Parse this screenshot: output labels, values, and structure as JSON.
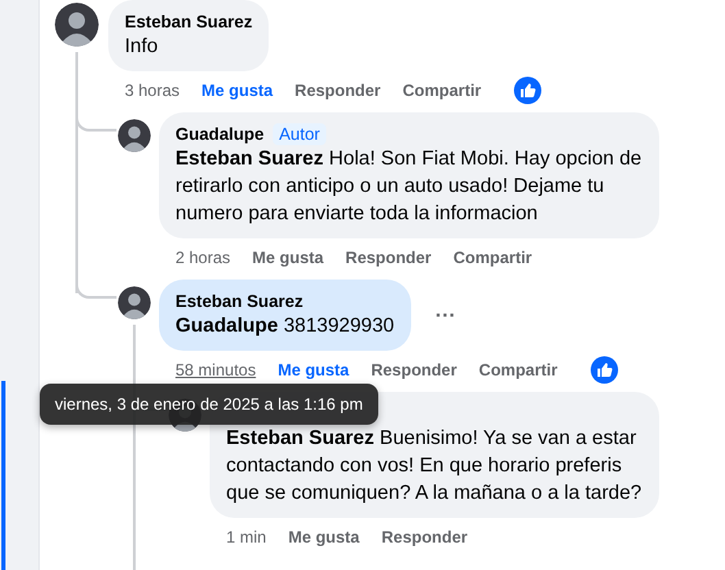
{
  "comments": [
    {
      "author": "Esteban Suarez",
      "text": "Info",
      "highlighted": false,
      "focused": false,
      "time": "3 horas",
      "time_hovered": false,
      "like_label": "Me gusta",
      "liked": true,
      "reply_label": "Responder",
      "share_label": "Compartir",
      "like_reaction": true,
      "children": [
        {
          "author": "Guadalupe",
          "badge": "Autor",
          "text": "**Esteban Suarez** Hola! Son Fiat Mobi. Hay opcion de retirarlo con anticipo o un auto usado! Dejame tu numero para enviarte toda la informacion",
          "highlighted": false,
          "focused": false,
          "time": "2 horas",
          "time_hovered": false,
          "like_label": "Me gusta",
          "liked": false,
          "reply_label": "Responder",
          "share_label": "Compartir",
          "like_reaction": false
        },
        {
          "author": "Esteban Suarez",
          "text": "**Guadalupe** 3813929930",
          "highlighted": true,
          "focused": false,
          "menu": "···",
          "time": "58 minutos",
          "time_hovered": true,
          "tooltip": "viernes, 3 de enero de 2025 a las 1:16 pm",
          "like_label": "Me gusta",
          "liked": true,
          "reply_label": "Responder",
          "share_label": "Compartir",
          "like_reaction": true,
          "children": [
            {
              "text": "**Esteban Suarez** Buenisimo! Ya se van a estar contactando con vos! En que horario preferis que se comuniquen? A la mañana o a la tarde?",
              "highlighted": false,
              "focused": true,
              "time": "1 min",
              "time_hovered": false,
              "like_label": "Me gusta",
              "liked": false,
              "reply_label": "Responder",
              "like_reaction": false
            }
          ]
        }
      ]
    }
  ]
}
